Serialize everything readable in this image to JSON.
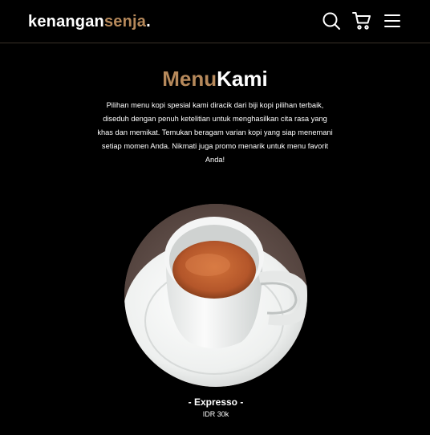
{
  "navbar": {
    "logo_part1": "kenangan",
    "logo_part2": "senja",
    "logo_dot": ".",
    "icons": [
      "search-icon",
      "shopping-cart-icon",
      "hamburger-menu-icon"
    ]
  },
  "colors": {
    "accent": "#b6895b",
    "background": "#000000",
    "text": "#ffffff"
  },
  "menu": {
    "title_part1": "Menu",
    "title_part2": "Kami",
    "description": "Pilihan menu kopi spesial kami diracik dari biji kopi pilihan terbaik, diseduh dengan penuh ketelitian untuk menghasilkan cita rasa yang khas dan memikat. Temukan beragam varian kopi yang siap menemani setiap momen Anda. Nikmati juga promo menarik untuk menu favorit Anda!",
    "items": [
      {
        "name": "- Expresso -",
        "price": "IDR 30k"
      }
    ]
  }
}
